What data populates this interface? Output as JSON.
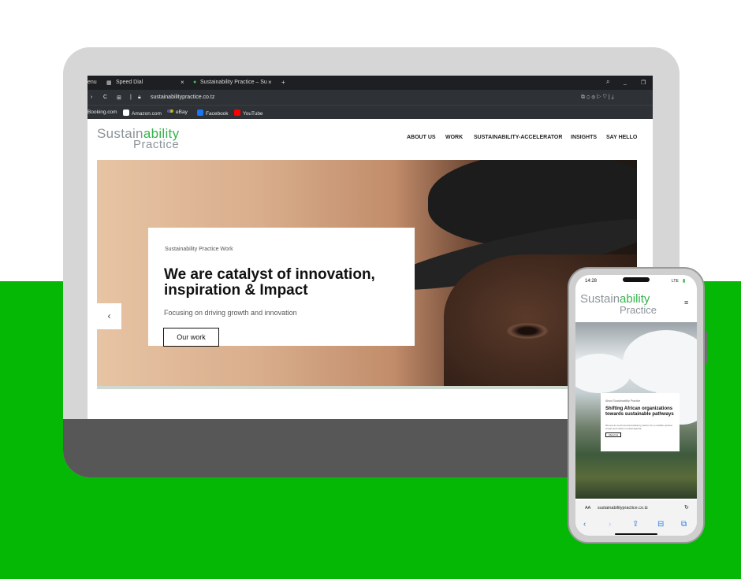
{
  "browser": {
    "tabs": [
      {
        "label": "enu"
      },
      {
        "label": "Speed Dial"
      },
      {
        "label": "Sustainability Practice – Su"
      }
    ],
    "new_tab": "+",
    "close_glyph": "×",
    "url": "sustainabilitypractice.co.tz",
    "nav_glyphs": {
      "forward": "›",
      "reload": "C",
      "grid": "⊞"
    },
    "bookmarks": [
      {
        "label": "Booking.com",
        "icon": "booking-icon",
        "color": "#3a5ba0"
      },
      {
        "label": "Amazon.com",
        "icon": "amazon-icon",
        "color": "#ffffff"
      },
      {
        "label": "eBay",
        "icon": "ebay-icon",
        "color": "#e53238"
      },
      {
        "label": "Facebook",
        "icon": "facebook-icon",
        "color": "#1877f2"
      },
      {
        "label": "YouTube",
        "icon": "youtube-icon",
        "color": "#ff0000"
      }
    ]
  },
  "site": {
    "logo": {
      "part1": "Sustain",
      "accent": "ability",
      "part2": "Practice"
    },
    "nav": [
      {
        "label": "ABOUT US"
      },
      {
        "label": "WORK"
      },
      {
        "label": "SUSTAINABILITY-ACCELERATOR"
      },
      {
        "label": "INSIGHTS"
      },
      {
        "label": "SAY HELLO"
      }
    ],
    "hero": {
      "kicker": "Sustainability Practice Work",
      "headline": "We are catalyst of innovation, inspiration & Impact",
      "subtext": "Focusing on driving growth and innovation",
      "cta": "Our work",
      "prev_glyph": "‹"
    }
  },
  "phone": {
    "time": "14:28",
    "signal": "LTE",
    "menu_glyph": "≡",
    "card": {
      "kicker": "About Sustainability Practice",
      "headline": "Shifting African organizations towards sustainable pathways",
      "subtext": "We are an environmental advisory partner for a credible positive impact and carbon neutral agenda.",
      "cta": "About Us"
    },
    "url_bar": {
      "aa": "AA",
      "url": "sustainabilitypractice.co.tz",
      "reload": "↻"
    },
    "toolbar": {
      "back": "‹",
      "forward": "›",
      "share": "⇪",
      "bookmarks": "⊟",
      "tabs": "⧉"
    }
  },
  "colors": {
    "brand_green": "#06b806",
    "logo_green": "#34b34a",
    "logo_gray": "#8c9499"
  }
}
